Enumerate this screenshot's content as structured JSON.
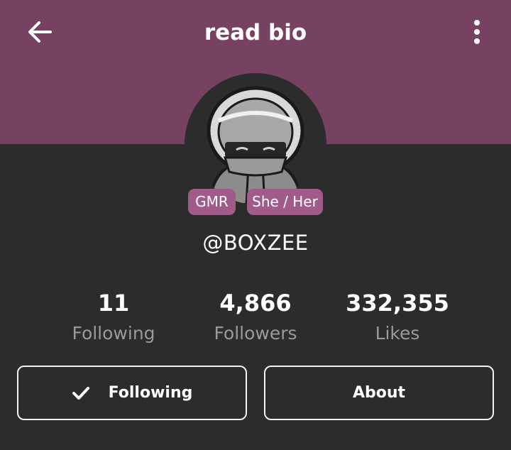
{
  "header": {
    "title": "read bio",
    "back_icon": "arrow-left-icon",
    "menu_icon": "more-vertical-icon",
    "background": "#774261"
  },
  "profile": {
    "avatar_icon": "hooded-character-avatar",
    "tags": [
      "GMR",
      "She / Her"
    ],
    "tag_color": "#a15b88",
    "username": "@BOXZEE"
  },
  "stats": [
    {
      "value": "11",
      "label": "Following"
    },
    {
      "value": "4,866",
      "label": "Followers"
    },
    {
      "value": "332,355",
      "label": "Likes"
    }
  ],
  "actions": {
    "following_label": "Following",
    "following_icon": "checkmark-icon",
    "about_label": "About"
  }
}
